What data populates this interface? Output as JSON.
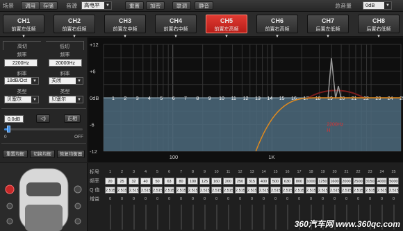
{
  "topbar": {
    "scene_label": "场景",
    "btn_call": "调用",
    "btn_save": "存储",
    "source_label": "音源",
    "source_value": "高电平",
    "btn_reset": "重置",
    "btn_encrypt": "加密",
    "btn_linkage": "联调",
    "btn_mute": "静音",
    "master_volume_label": "总音量",
    "master_volume_value": "0dB"
  },
  "channels": [
    {
      "name": "CH1",
      "sub": "前置左低频"
    },
    {
      "name": "CH2",
      "sub": "前置右低频"
    },
    {
      "name": "CH3",
      "sub": "前置左中频"
    },
    {
      "name": "CH4",
      "sub": "前置右中频"
    },
    {
      "name": "CH5",
      "sub": "前置左高频"
    },
    {
      "name": "CH6",
      "sub": "前置右高频"
    },
    {
      "name": "CH7",
      "sub": "后置左低频"
    },
    {
      "name": "CH8",
      "sub": "后置右低频"
    }
  ],
  "active_channel": 4,
  "crossover": {
    "hp_title": "高切",
    "lp_title": "低切",
    "freq_label": "频率",
    "hp_freq": "2200Hz",
    "lp_freq": "20000Hz",
    "slope_label": "斜率",
    "hp_slope": "18dB/Oct",
    "lp_slope": "关闭",
    "type_label": "类型",
    "hp_type": "贝塞尔",
    "lp_type": "贝塞尔"
  },
  "volume": {
    "value": "0.0dB",
    "phase_label": "正相",
    "slider_min": "0",
    "slider_max": "OFF",
    "level": 0.05
  },
  "eq_buttons": {
    "reset": "重置均衡",
    "bypass": "切换均衡",
    "restore": "恢复均衡器"
  },
  "graph": {
    "y_ticks": [
      "+12",
      "+6",
      "0dB",
      "-6",
      "-12"
    ],
    "x_ticks": [
      "100",
      "1K"
    ],
    "band_labels": [
      "1",
      "2",
      "3",
      "4",
      "5",
      "6",
      "7",
      "8",
      "9",
      "10",
      "11",
      "12",
      "13",
      "14",
      "15",
      "16",
      "17",
      "18",
      "19",
      "20",
      "21",
      "22",
      "23",
      "24",
      "25"
    ],
    "marker_label": "2200Hz",
    "marker_sub": "H",
    "colors": {
      "fill": "#4c6a7d",
      "curve": "#e08a1e",
      "marker": "#e03030"
    }
  },
  "eq_table": {
    "row_labels": {
      "band": "标号",
      "freq": "频率",
      "q": "Q 值",
      "gain": "增益"
    },
    "bands": [
      "1",
      "2",
      "3",
      "4",
      "5",
      "6",
      "7",
      "8",
      "9",
      "10",
      "11",
      "12",
      "13",
      "14",
      "15",
      "16",
      "17",
      "18",
      "19",
      "20",
      "21",
      "22",
      "23",
      "24",
      "25"
    ],
    "freqs": [
      "20",
      "25",
      "32",
      "40",
      "50",
      "63",
      "80",
      "100",
      "125",
      "160",
      "200",
      "250",
      "315",
      "400",
      "500",
      "630",
      "800",
      "1000",
      "1250",
      "1600",
      "2000",
      "2500",
      "3150",
      "4000",
      "5000"
    ],
    "q_values": [
      "2.515",
      "2.515",
      "2.515",
      "2.515",
      "2.515",
      "2.515",
      "2.515",
      "2.515",
      "2.515",
      "2.515",
      "2.515",
      "2.515",
      "2.515",
      "2.515",
      "2.515",
      "2.515",
      "2.515",
      "2.515",
      "2.515",
      "2.515",
      "2.515",
      "2.515",
      "2.515",
      "2.515",
      "2.515"
    ],
    "gains": [
      "0",
      "0",
      "0",
      "0",
      "0",
      "0",
      "0",
      "0",
      "0",
      "0",
      "0",
      "0",
      "0",
      "0",
      "0",
      "0",
      "0",
      "0",
      "0",
      "0",
      "0",
      "0",
      "0",
      "0",
      "0"
    ]
  },
  "watermark": "360汽车网 www.360qc.com"
}
